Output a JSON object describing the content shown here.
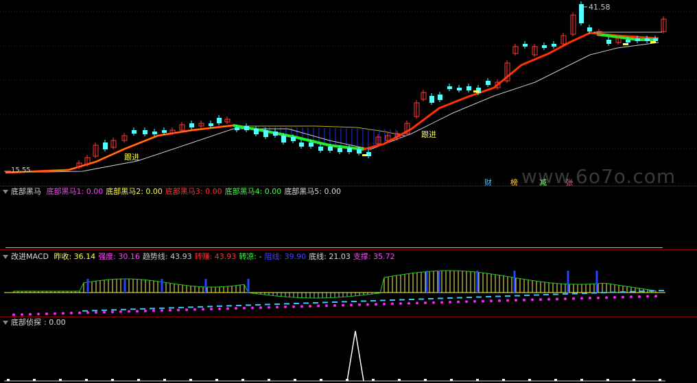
{
  "main": {
    "price_high_label": "41.58",
    "price_low_label": "15.55",
    "signal_label": "跟进",
    "watermark": "www.6o7o.com",
    "badges": [
      {
        "text": "财",
        "color": "#4fc3ff"
      },
      {
        "text": "榜",
        "color": "#ffd24a"
      },
      {
        "text": "减",
        "color": "#7cff7c"
      },
      {
        "text": "张",
        "color": "#ff4d6a"
      }
    ]
  },
  "panel1": {
    "title": "底部黑马",
    "items": [
      {
        "label": "底部黑马1: 0.00",
        "color": "#ff44ff"
      },
      {
        "label": "底部黑马2: 0.00",
        "color": "#ffff44"
      },
      {
        "label": "底部黑马3: 0.00",
        "color": "#ff3333"
      },
      {
        "label": "底部黑马4: 0.00",
        "color": "#44ff44"
      },
      {
        "label": "底部黑马5: 0.00",
        "color": "#dddddd"
      }
    ]
  },
  "panel2": {
    "title": "改进MACD",
    "items": [
      {
        "label": "昨收: 36.14",
        "color": "#ffff44"
      },
      {
        "label": "强度: 30.16",
        "color": "#ff44ff"
      },
      {
        "label": "趋势线: 43.93",
        "color": "#cccccc"
      },
      {
        "label": "转赚: 43.93",
        "color": "#ff3333"
      },
      {
        "label": "转凉: -",
        "color": "#44ff44"
      },
      {
        "label": "阻线: 39.90",
        "color": "#4444ff"
      },
      {
        "label": "底线: 21.03",
        "color": "#dddddd"
      },
      {
        "label": "支撑: 35.72",
        "color": "#ff44ff"
      }
    ]
  },
  "panel3": {
    "title": "底部侦探",
    "value_label": ": 0.00"
  },
  "colors": {
    "up": "#ff3b3b",
    "down": "#54ffff",
    "ma_fast": "#ff3300",
    "ma_slow": "#cccccc",
    "separator": "#8b0000"
  }
}
